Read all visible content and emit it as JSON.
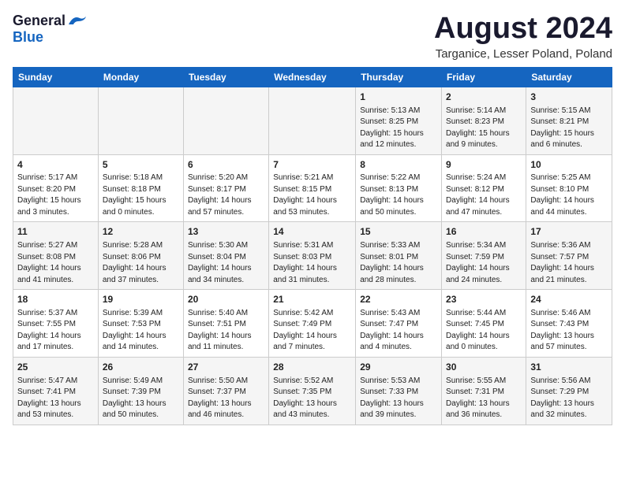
{
  "logo": {
    "general": "General",
    "blue": "Blue"
  },
  "title": "August 2024",
  "subtitle": "Targanice, Lesser Poland, Poland",
  "days_of_week": [
    "Sunday",
    "Monday",
    "Tuesday",
    "Wednesday",
    "Thursday",
    "Friday",
    "Saturday"
  ],
  "weeks": [
    [
      {
        "day": "",
        "info": ""
      },
      {
        "day": "",
        "info": ""
      },
      {
        "day": "",
        "info": ""
      },
      {
        "day": "",
        "info": ""
      },
      {
        "day": "1",
        "info": "Sunrise: 5:13 AM\nSunset: 8:25 PM\nDaylight: 15 hours\nand 12 minutes."
      },
      {
        "day": "2",
        "info": "Sunrise: 5:14 AM\nSunset: 8:23 PM\nDaylight: 15 hours\nand 9 minutes."
      },
      {
        "day": "3",
        "info": "Sunrise: 5:15 AM\nSunset: 8:21 PM\nDaylight: 15 hours\nand 6 minutes."
      }
    ],
    [
      {
        "day": "4",
        "info": "Sunrise: 5:17 AM\nSunset: 8:20 PM\nDaylight: 15 hours\nand 3 minutes."
      },
      {
        "day": "5",
        "info": "Sunrise: 5:18 AM\nSunset: 8:18 PM\nDaylight: 15 hours\nand 0 minutes."
      },
      {
        "day": "6",
        "info": "Sunrise: 5:20 AM\nSunset: 8:17 PM\nDaylight: 14 hours\nand 57 minutes."
      },
      {
        "day": "7",
        "info": "Sunrise: 5:21 AM\nSunset: 8:15 PM\nDaylight: 14 hours\nand 53 minutes."
      },
      {
        "day": "8",
        "info": "Sunrise: 5:22 AM\nSunset: 8:13 PM\nDaylight: 14 hours\nand 50 minutes."
      },
      {
        "day": "9",
        "info": "Sunrise: 5:24 AM\nSunset: 8:12 PM\nDaylight: 14 hours\nand 47 minutes."
      },
      {
        "day": "10",
        "info": "Sunrise: 5:25 AM\nSunset: 8:10 PM\nDaylight: 14 hours\nand 44 minutes."
      }
    ],
    [
      {
        "day": "11",
        "info": "Sunrise: 5:27 AM\nSunset: 8:08 PM\nDaylight: 14 hours\nand 41 minutes."
      },
      {
        "day": "12",
        "info": "Sunrise: 5:28 AM\nSunset: 8:06 PM\nDaylight: 14 hours\nand 37 minutes."
      },
      {
        "day": "13",
        "info": "Sunrise: 5:30 AM\nSunset: 8:04 PM\nDaylight: 14 hours\nand 34 minutes."
      },
      {
        "day": "14",
        "info": "Sunrise: 5:31 AM\nSunset: 8:03 PM\nDaylight: 14 hours\nand 31 minutes."
      },
      {
        "day": "15",
        "info": "Sunrise: 5:33 AM\nSunset: 8:01 PM\nDaylight: 14 hours\nand 28 minutes."
      },
      {
        "day": "16",
        "info": "Sunrise: 5:34 AM\nSunset: 7:59 PM\nDaylight: 14 hours\nand 24 minutes."
      },
      {
        "day": "17",
        "info": "Sunrise: 5:36 AM\nSunset: 7:57 PM\nDaylight: 14 hours\nand 21 minutes."
      }
    ],
    [
      {
        "day": "18",
        "info": "Sunrise: 5:37 AM\nSunset: 7:55 PM\nDaylight: 14 hours\nand 17 minutes."
      },
      {
        "day": "19",
        "info": "Sunrise: 5:39 AM\nSunset: 7:53 PM\nDaylight: 14 hours\nand 14 minutes."
      },
      {
        "day": "20",
        "info": "Sunrise: 5:40 AM\nSunset: 7:51 PM\nDaylight: 14 hours\nand 11 minutes."
      },
      {
        "day": "21",
        "info": "Sunrise: 5:42 AM\nSunset: 7:49 PM\nDaylight: 14 hours\nand 7 minutes."
      },
      {
        "day": "22",
        "info": "Sunrise: 5:43 AM\nSunset: 7:47 PM\nDaylight: 14 hours\nand 4 minutes."
      },
      {
        "day": "23",
        "info": "Sunrise: 5:44 AM\nSunset: 7:45 PM\nDaylight: 14 hours\nand 0 minutes."
      },
      {
        "day": "24",
        "info": "Sunrise: 5:46 AM\nSunset: 7:43 PM\nDaylight: 13 hours\nand 57 minutes."
      }
    ],
    [
      {
        "day": "25",
        "info": "Sunrise: 5:47 AM\nSunset: 7:41 PM\nDaylight: 13 hours\nand 53 minutes."
      },
      {
        "day": "26",
        "info": "Sunrise: 5:49 AM\nSunset: 7:39 PM\nDaylight: 13 hours\nand 50 minutes."
      },
      {
        "day": "27",
        "info": "Sunrise: 5:50 AM\nSunset: 7:37 PM\nDaylight: 13 hours\nand 46 minutes."
      },
      {
        "day": "28",
        "info": "Sunrise: 5:52 AM\nSunset: 7:35 PM\nDaylight: 13 hours\nand 43 minutes."
      },
      {
        "day": "29",
        "info": "Sunrise: 5:53 AM\nSunset: 7:33 PM\nDaylight: 13 hours\nand 39 minutes."
      },
      {
        "day": "30",
        "info": "Sunrise: 5:55 AM\nSunset: 7:31 PM\nDaylight: 13 hours\nand 36 minutes."
      },
      {
        "day": "31",
        "info": "Sunrise: 5:56 AM\nSunset: 7:29 PM\nDaylight: 13 hours\nand 32 minutes."
      }
    ]
  ]
}
